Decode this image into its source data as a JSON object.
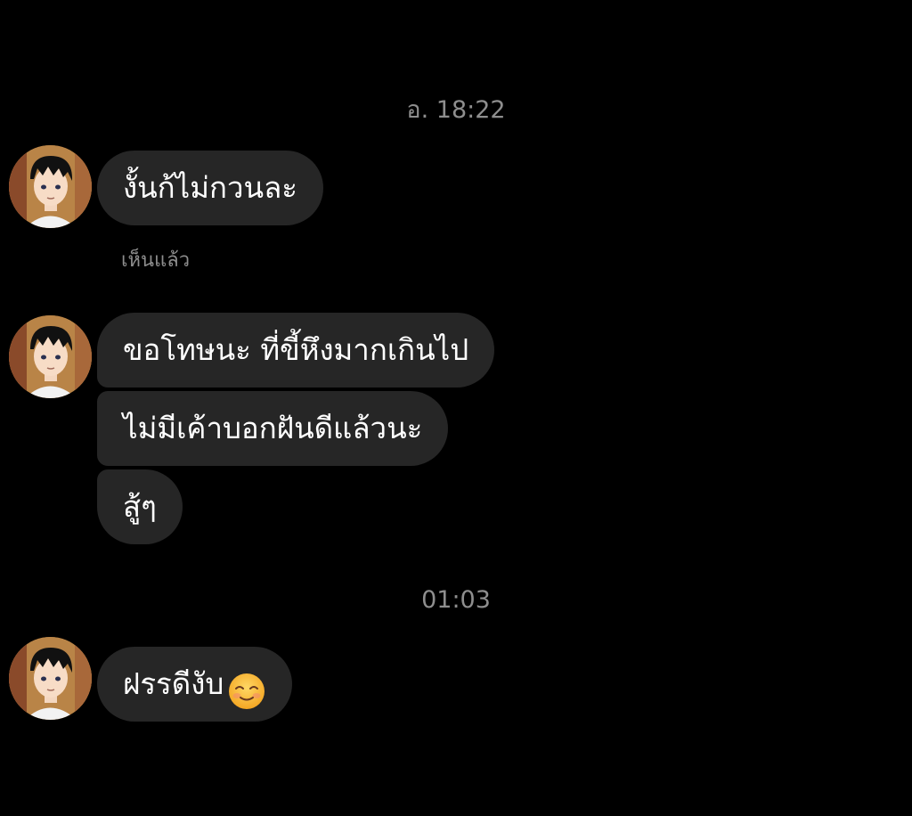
{
  "chat": {
    "timestamps": [
      "อ. 18:22",
      "01:03"
    ],
    "seen_label": "เห็นแล้ว",
    "messages": [
      "งั้นก้ไม่กวนละ",
      "ขอโทษนะ ที่ขี้หึงมากเกินไป",
      "ไม่มีเค้าบอกฝันดีแล้วนะ",
      "สู้ๆ",
      "ฝรรดีงับ"
    ],
    "reaction_emoji": "smiling-face-icon"
  },
  "colors": {
    "background": "#000000",
    "bubble": "#262626",
    "meta_text": "#8e8e8e",
    "message_text": "#ffffff"
  }
}
